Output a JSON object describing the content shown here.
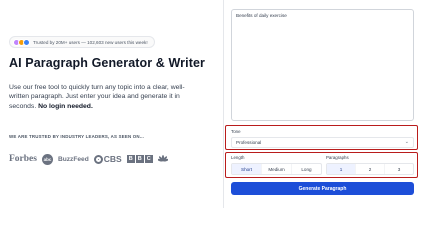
{
  "hero": {
    "trust_text": "Trusted by 20M+ users — 102,603 new users this week!",
    "title": "AI Paragraph Generator & Writer",
    "desc_part1": "Use our free tool to quickly turn any topic into a clear, well-written paragraph. Just enter your idea and generate it in seconds. ",
    "desc_bold": "No login needed.",
    "trusted_by": "WE ARE TRUSTED BY INDUSTRY LEADERS, AS SEEN ON...",
    "avatar_colors": [
      "#c084fc",
      "#f59e0b",
      "#3b82f6"
    ]
  },
  "logos": {
    "forbes": "Forbes",
    "abc": "abc",
    "buzzfeed": "BuzzFeed",
    "cbs": "CBS",
    "bbc": [
      "B",
      "B",
      "C"
    ]
  },
  "form": {
    "topic_value": "Benefits of daily exercise",
    "tone_label": "Tone",
    "tone_value": "Professional",
    "length_label": "Length",
    "length_options": [
      "Short",
      "Medium",
      "Long"
    ],
    "length_selected": "Short",
    "paragraphs_label": "Paragraphs",
    "paragraph_options": [
      "1",
      "2",
      "3"
    ],
    "paragraphs_selected": "1",
    "generate_label": "Generate Paragraph"
  },
  "colors": {
    "accent": "#1d4ed8",
    "highlight_border": "#b91c1c"
  }
}
